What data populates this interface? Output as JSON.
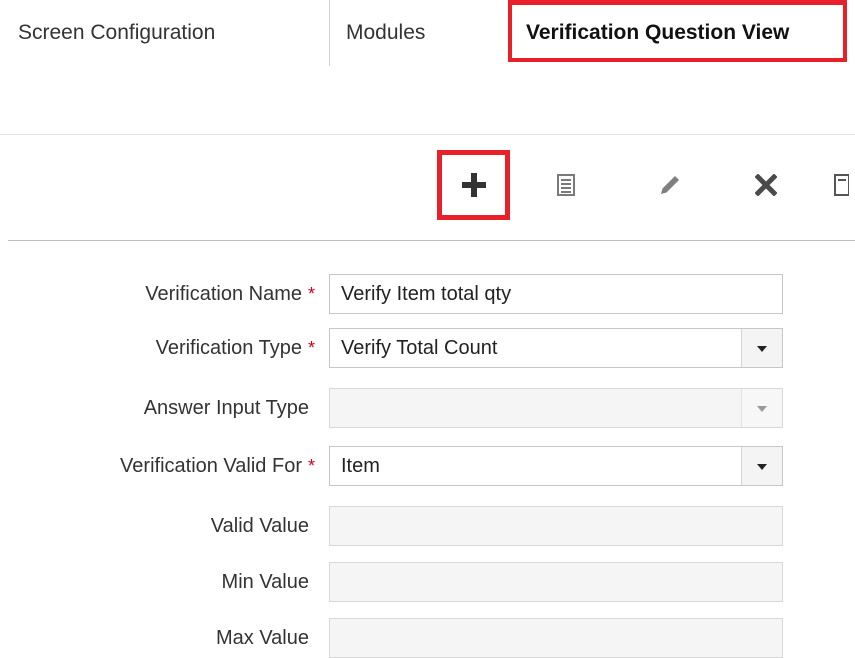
{
  "tabs": [
    {
      "label": "Screen Configuration"
    },
    {
      "label": "Modules"
    },
    {
      "label": "Verification Question View"
    }
  ],
  "colors": {
    "highlight": "#e8202a",
    "required": "#d0021b"
  },
  "toolbar": {
    "icons": [
      "add-icon",
      "list-icon",
      "edit-icon",
      "delete-icon",
      "more-icon"
    ]
  },
  "form": {
    "required_mark": "*",
    "verification_name": {
      "label": "Verification Name",
      "value": "Verify Item total qty"
    },
    "verification_type": {
      "label": "Verification Type",
      "value": "Verify Total Count"
    },
    "answer_input_type": {
      "label": "Answer Input Type",
      "value": ""
    },
    "verification_valid_for": {
      "label": "Verification Valid For",
      "value": "Item"
    },
    "valid_value": {
      "label": "Valid Value",
      "value": ""
    },
    "min_value": {
      "label": "Min Value",
      "value": ""
    },
    "max_value": {
      "label": "Max Value",
      "value": ""
    }
  }
}
